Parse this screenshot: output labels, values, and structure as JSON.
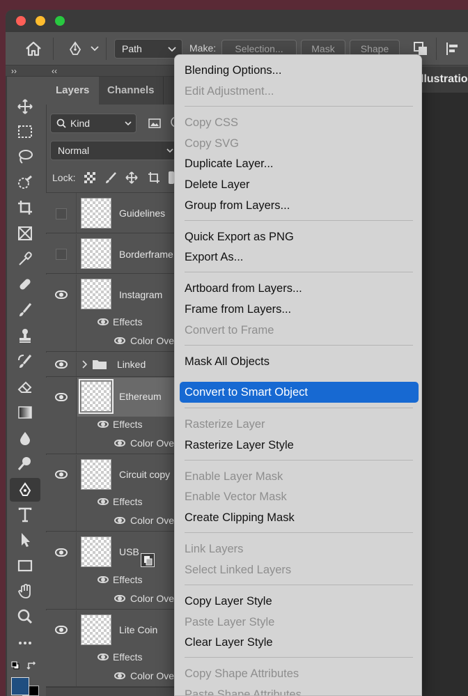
{
  "app": {
    "options_bar": {
      "path_select": "Path",
      "make_label": "Make:",
      "selection_btn": "Selection...",
      "mask_btn": "Mask",
      "shape_btn": "Shape"
    },
    "doc_tab_partial": "llustratio",
    "panel_collapse_left": "››",
    "panel_collapse_right": "‹‹"
  },
  "layers_panel": {
    "tabs": [
      "Layers",
      "Channels"
    ],
    "filter_kind": "Kind",
    "blend_mode": "Normal",
    "lock_label": "Lock:",
    "layers": [
      {
        "name": "Guidelines",
        "visible": false
      },
      {
        "name": "Borderframe",
        "visible": false
      },
      {
        "name": "Instagram",
        "visible": true,
        "effects": "Effects",
        "effect_item": "Color Overlay"
      },
      {
        "name": "Linked",
        "visible": true,
        "group": true
      },
      {
        "name": "Ethereum",
        "visible": true,
        "selected": true,
        "effects": "Effects",
        "effect_item": "Color Overlay"
      },
      {
        "name": "Circuit copy",
        "visible": true,
        "effects": "Effects",
        "effect_item": "Color Overlay"
      },
      {
        "name": "USB",
        "visible": true,
        "effects": "Effects",
        "effect_item": "Color Overlay"
      },
      {
        "name": "Lite Coin",
        "visible": true,
        "effects": "Effects",
        "effect_item": "Color Overlay"
      }
    ]
  },
  "context_menu": {
    "items": [
      {
        "label": "Blending Options...",
        "enabled": true
      },
      {
        "label": "Edit Adjustment...",
        "enabled": false
      },
      {
        "label": "Copy CSS",
        "enabled": false
      },
      {
        "label": "Copy SVG",
        "enabled": false
      },
      {
        "label": "Duplicate Layer...",
        "enabled": true
      },
      {
        "label": "Delete Layer",
        "enabled": true
      },
      {
        "label": "Group from Layers...",
        "enabled": true
      },
      {
        "label": "Quick Export as PNG",
        "enabled": true
      },
      {
        "label": "Export As...",
        "enabled": true
      },
      {
        "label": "Artboard from Layers...",
        "enabled": true
      },
      {
        "label": "Frame from Layers...",
        "enabled": true
      },
      {
        "label": "Convert to Frame",
        "enabled": false
      },
      {
        "label": "Mask All Objects",
        "enabled": true
      },
      {
        "label": "Convert to Smart Object",
        "enabled": true,
        "highlighted": true
      },
      {
        "label": "Rasterize Layer",
        "enabled": false
      },
      {
        "label": "Rasterize Layer Style",
        "enabled": true
      },
      {
        "label": "Enable Layer Mask",
        "enabled": false
      },
      {
        "label": "Enable Vector Mask",
        "enabled": false
      },
      {
        "label": "Create Clipping Mask",
        "enabled": true
      },
      {
        "label": "Link Layers",
        "enabled": false
      },
      {
        "label": "Select Linked Layers",
        "enabled": false
      },
      {
        "label": "Copy Layer Style",
        "enabled": true
      },
      {
        "label": "Paste Layer Style",
        "enabled": false
      },
      {
        "label": "Clear Layer Style",
        "enabled": true
      },
      {
        "label": "Copy Shape Attributes",
        "enabled": false
      },
      {
        "label": "Paste Shape Attributes",
        "enabled": false
      }
    ]
  },
  "colors": {
    "highlight": "#1769d2",
    "foreground_swatch": "#1f4e80",
    "background_swatch": "#000000"
  }
}
